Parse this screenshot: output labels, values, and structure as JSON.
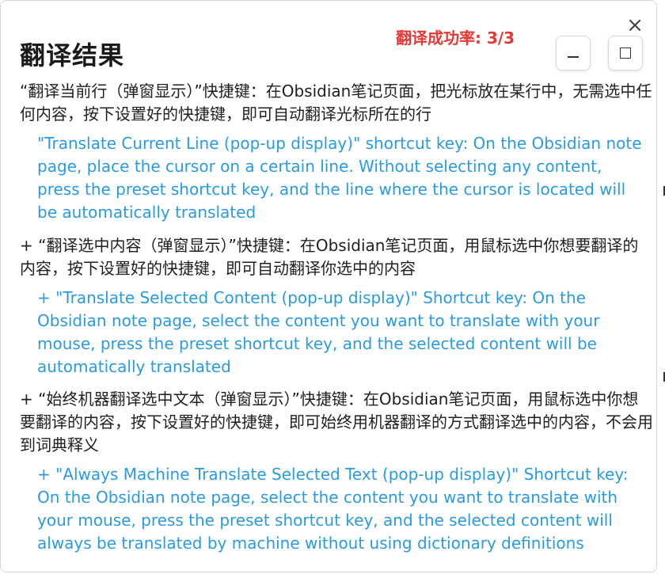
{
  "dialog": {
    "title": "翻译结果",
    "success_rate": "翻译成功率: 3/3",
    "close_symbol": "×"
  },
  "entries": [
    {
      "source": "“翻译当前行（弹窗显示）”快捷键：在Obsidian笔记页面，把光标放在某行中，无需选中任何内容，按下设置好的快捷键，即可自动翻译光标所在的行",
      "translation": "\"Translate Current Line (pop-up display)\" shortcut key: On the Obsidian note page, place the cursor on a certain line. Without selecting any content, press the preset shortcut key, and the line where the cursor is located will be automatically translated"
    },
    {
      "source": "+ “翻译选中内容（弹窗显示）”快捷键：在Obsidian笔记页面，用鼠标选中你想要翻译的内容，按下设置好的快捷键，即可自动翻译你选中的内容",
      "translation": "+ \"Translate Selected Content (pop-up display)\" Shortcut key: On the Obsidian note page, select the content you want to translate with your mouse, press the preset shortcut key, and the selected content will be automatically translated"
    },
    {
      "source": "+ “始终机器翻译选中文本（弹窗显示）”快捷键：在Obsidian笔记页面，用鼠标选中你想要翻译的内容，按下设置好的快捷键，即可始终用机器翻译的方式翻译选中的内容，不会用到词典释义",
      "translation": "+ \"Always Machine Translate Selected Text (pop-up display)\" Shortcut key: On the Obsidian note page, select the content you want to translate with your mouse, press the preset shortcut key, and the selected content will always be translated by machine without using dictionary definitions"
    }
  ],
  "colors": {
    "accent_red": "#e53935",
    "translation_blue": "#2a9be0",
    "source_text": "#1f1f1f"
  },
  "icons": {
    "close": "close-icon",
    "minimize": "minimize-icon",
    "maximize": "maximize-icon"
  }
}
